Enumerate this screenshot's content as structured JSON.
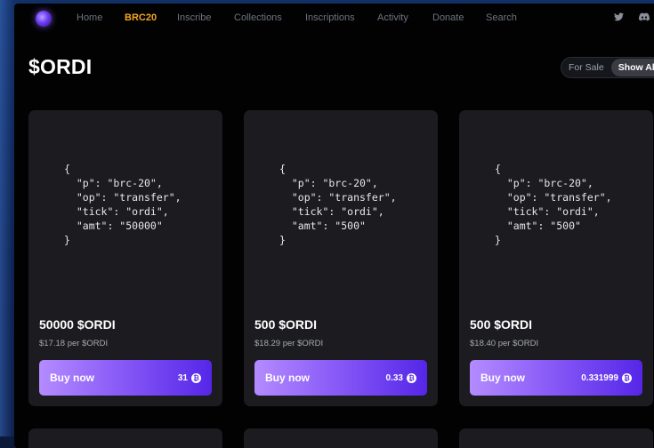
{
  "nav": {
    "items": [
      "Home",
      "BRC20",
      "Inscribe",
      "Collections",
      "Inscriptions",
      "Activity",
      "Donate",
      "Search"
    ],
    "active_index": 1,
    "accent_color": "#f5a524"
  },
  "icons": [
    "logo-icon",
    "twitter-icon",
    "discord-icon",
    "bitcoin-icon"
  ],
  "page": {
    "title": "$ORDI"
  },
  "toggle": {
    "options": [
      "For Sale",
      "Show All"
    ],
    "selected_index": 1
  },
  "cards": [
    {
      "code_lines": [
        "{",
        "  \"p\": \"brc-20\",",
        "  \"op\": \"transfer\",",
        "  \"tick\": \"ordi\",",
        "  \"amt\": \"50000\"",
        "}"
      ],
      "amount": "50000 $ORDI",
      "unit_price": "$17.18 per $ORDI",
      "buy_label": "Buy now",
      "price": "31"
    },
    {
      "code_lines": [
        "{",
        "  \"p\": \"brc-20\",",
        "  \"op\": \"transfer\",",
        "  \"tick\": \"ordi\",",
        "  \"amt\": \"500\"",
        "}"
      ],
      "amount": "500 $ORDI",
      "unit_price": "$18.29 per $ORDI",
      "buy_label": "Buy now",
      "price": "0.33"
    },
    {
      "code_lines": [
        "{",
        "  \"p\": \"brc-20\",",
        "  \"op\": \"transfer\",",
        "  \"tick\": \"ordi\",",
        "  \"amt\": \"500\"",
        "}"
      ],
      "amount": "500 $ORDI",
      "unit_price": "$18.40 per $ORDI",
      "buy_label": "Buy now",
      "price": "0.331999"
    }
  ],
  "theme": {
    "button_gradient": [
      "#b48bff",
      "#8a5cf7",
      "#5526e8"
    ],
    "card_bg": "#1b1b20",
    "page_bg": "#020203"
  }
}
